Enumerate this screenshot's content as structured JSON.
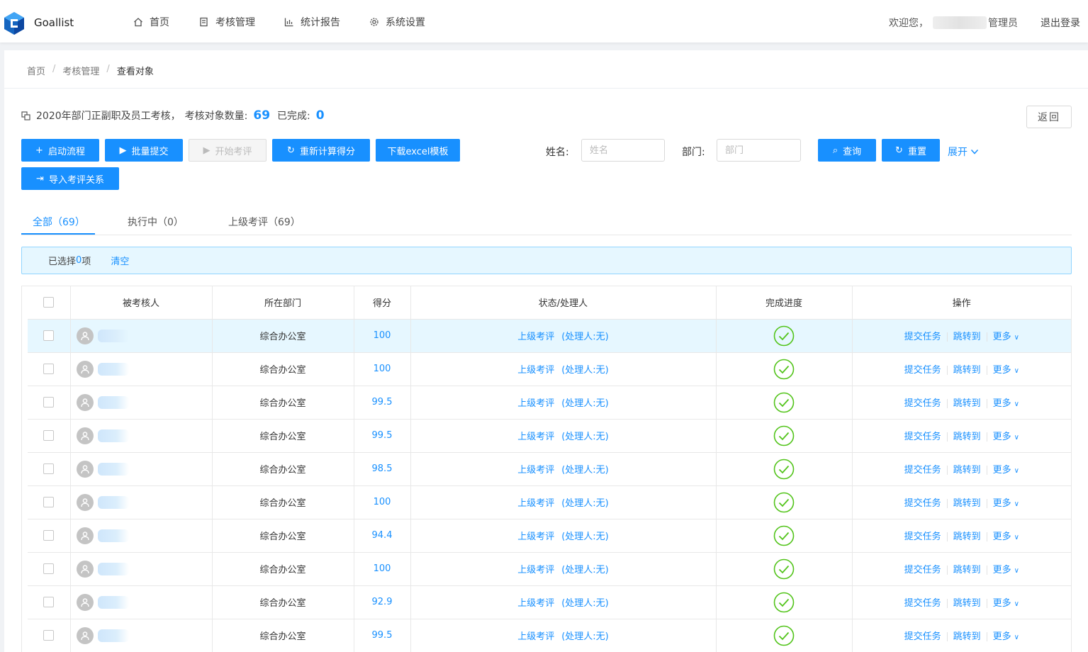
{
  "header": {
    "brand": "Goallist",
    "nav": [
      {
        "label": "首页",
        "icon": "home-icon"
      },
      {
        "label": "考核管理",
        "icon": "document-icon"
      },
      {
        "label": "统计报告",
        "icon": "bar-chart-icon"
      },
      {
        "label": "系统设置",
        "icon": "gear-icon"
      }
    ],
    "welcome_prefix": "欢迎您，",
    "welcome_suffix": "管理员",
    "logout": "退出登录"
  },
  "breadcrumb": [
    "首页",
    "考核管理",
    "查看对象"
  ],
  "summary": {
    "title": "2020年部门正副职及员工考核，",
    "count_label": "考核对象数量:",
    "count": "69",
    "done_label": "已完成:",
    "done": "0",
    "back": "返回"
  },
  "toolbar": {
    "start_flow": "启动流程",
    "batch_submit": "批量提交",
    "start_review": "开始考评",
    "recalc": "重新计算得分",
    "download_tpl": "下载excel模板",
    "import_rel": "导入考评关系"
  },
  "filters": {
    "name_label": "姓名:",
    "name_placeholder": "姓名",
    "dept_label": "部门:",
    "dept_placeholder": "部门",
    "query": "查询",
    "reset": "重置",
    "expand": "展开"
  },
  "tabs": [
    {
      "label": "全部（69）",
      "active": true
    },
    {
      "label": "执行中（0）",
      "active": false
    },
    {
      "label": "上级考评（69）",
      "active": false
    }
  ],
  "selection": {
    "prefix": "已选择 ",
    "count": "0",
    "suffix": "项",
    "clear": "清空"
  },
  "table": {
    "columns": [
      "被考核人",
      "所在部门",
      "得分",
      "状态/处理人",
      "完成进度",
      "操作"
    ],
    "ops": {
      "submit": "提交任务",
      "jump": "跳转到",
      "more": "更多"
    },
    "rows": [
      {
        "dept": "综合办公室",
        "score": "100",
        "status": "上级考评",
        "handler": "(处理人:无)"
      },
      {
        "dept": "综合办公室",
        "score": "100",
        "status": "上级考评",
        "handler": "(处理人:无)"
      },
      {
        "dept": "综合办公室",
        "score": "99.5",
        "status": "上级考评",
        "handler": "(处理人:无)"
      },
      {
        "dept": "综合办公室",
        "score": "99.5",
        "status": "上级考评",
        "handler": "(处理人:无)"
      },
      {
        "dept": "综合办公室",
        "score": "98.5",
        "status": "上级考评",
        "handler": "(处理人:无)"
      },
      {
        "dept": "综合办公室",
        "score": "100",
        "status": "上级考评",
        "handler": "(处理人:无)"
      },
      {
        "dept": "综合办公室",
        "score": "94.4",
        "status": "上级考评",
        "handler": "(处理人:无)"
      },
      {
        "dept": "综合办公室",
        "score": "100",
        "status": "上级考评",
        "handler": "(处理人:无)"
      },
      {
        "dept": "综合办公室",
        "score": "92.9",
        "status": "上级考评",
        "handler": "(处理人:无)"
      },
      {
        "dept": "综合办公室",
        "score": "99.5",
        "status": "上级考评",
        "handler": "(处理人:无)"
      }
    ]
  },
  "colors": {
    "primary": "#1890ff",
    "success": "#52c41a",
    "highlight_row": "#e6f7ff"
  }
}
